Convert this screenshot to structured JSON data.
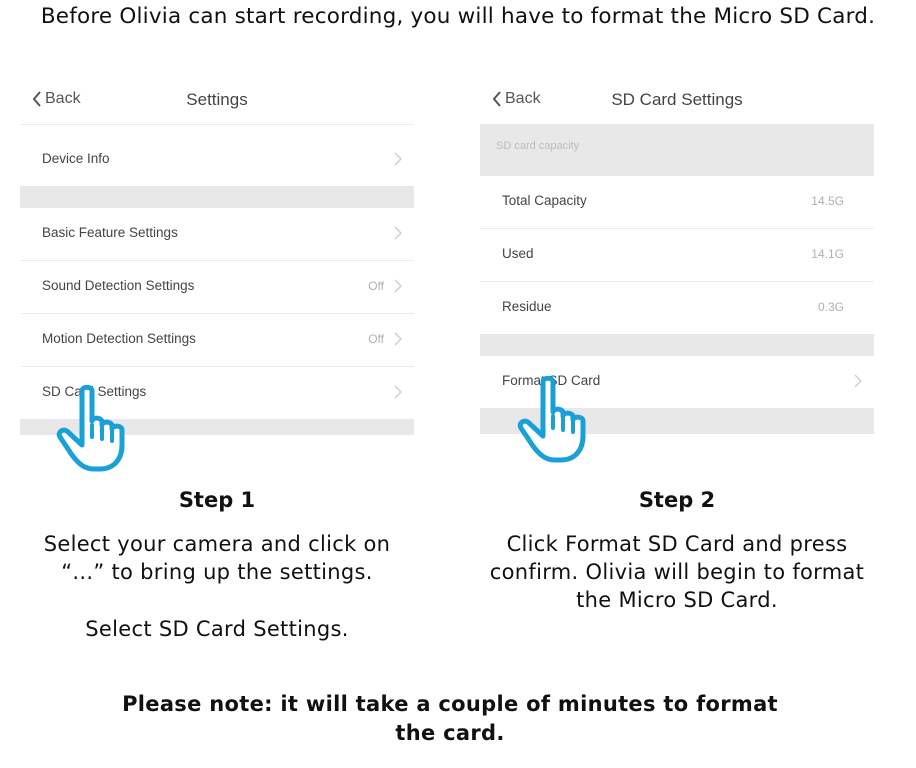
{
  "intro": "Before Olivia can start recording, you will have to format the Micro SD Card.",
  "screen1": {
    "back_label": "Back",
    "title": "Settings",
    "rows": [
      {
        "label": "Device Info",
        "value": ""
      },
      {
        "label": "Basic Feature Settings",
        "value": ""
      },
      {
        "label": "Sound Detection Settings",
        "value": "Off"
      },
      {
        "label": "Motion Detection Settings",
        "value": "Off"
      },
      {
        "label": "SD Card Settings",
        "value": ""
      }
    ]
  },
  "screen2": {
    "back_label": "Back",
    "title": "SD Card Settings",
    "section_header": "SD card capacity",
    "rows": [
      {
        "label": "Total Capacity",
        "value": "14.5G"
      },
      {
        "label": "Used",
        "value": "14.1G"
      },
      {
        "label": "Residue",
        "value": "0.3G"
      },
      {
        "label": "Format SD Card",
        "value": ""
      }
    ]
  },
  "step1": {
    "title": "Step 1",
    "text1": "Select your camera and click on",
    "text2": "“...” to bring up the settings.",
    "text3": "Select SD Card Settings."
  },
  "step2": {
    "title": "Step 2",
    "text1": "Click Format SD Card and press",
    "text2": "confirm. Olivia will begin to format",
    "text3": "the Micro SD Card."
  },
  "note": {
    "line1": "Please note: it will take a couple of minutes to format",
    "line2": "the card."
  },
  "colors": {
    "hand": "#1aa0d8",
    "divider": "#e8e8e8"
  }
}
